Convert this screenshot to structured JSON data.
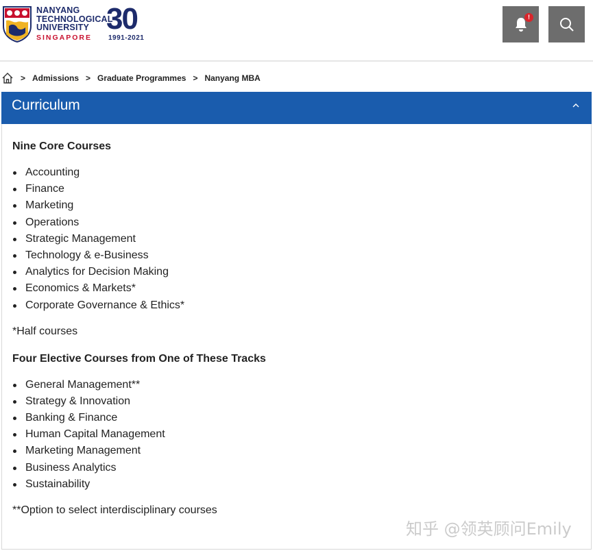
{
  "logo": {
    "line1": "NANYANG",
    "line2": "TECHNOLOGICAL",
    "line3": "UNIVERSITY",
    "line4": "SINGAPORE",
    "anniversary": "30",
    "years": "1991-2021"
  },
  "header": {
    "notification_badge": "!"
  },
  "breadcrumb": {
    "items": [
      "Admissions",
      "Graduate Programmes",
      "Nanyang MBA"
    ],
    "separator": ">"
  },
  "accordion": {
    "title": "Curriculum"
  },
  "content": {
    "core_title": "Nine Core Courses",
    "core_courses": [
      "Accounting",
      "Finance",
      "Marketing",
      "Operations",
      "Strategic Management",
      "Technology & e-Business",
      "Analytics for Decision Making",
      "Economics & Markets*",
      "Corporate Governance & Ethics*"
    ],
    "half_note": "*Half courses",
    "elective_title": "Four Elective Courses from One of These Tracks",
    "elective_tracks": [
      "General Management**",
      "Strategy & Innovation",
      "Banking & Finance",
      "Human Capital Management",
      "Marketing Management",
      "Business Analytics",
      "Sustainability"
    ],
    "option_note": "**Option to select interdisciplinary courses"
  },
  "watermark": "知乎 @领英顾问Emily",
  "colors": {
    "accordion_bg": "#1a5cad",
    "header_button_bg": "#6d6d6d",
    "badge": "#d9262c",
    "brand_navy": "#1d2b6b",
    "brand_red": "#c8102e"
  }
}
